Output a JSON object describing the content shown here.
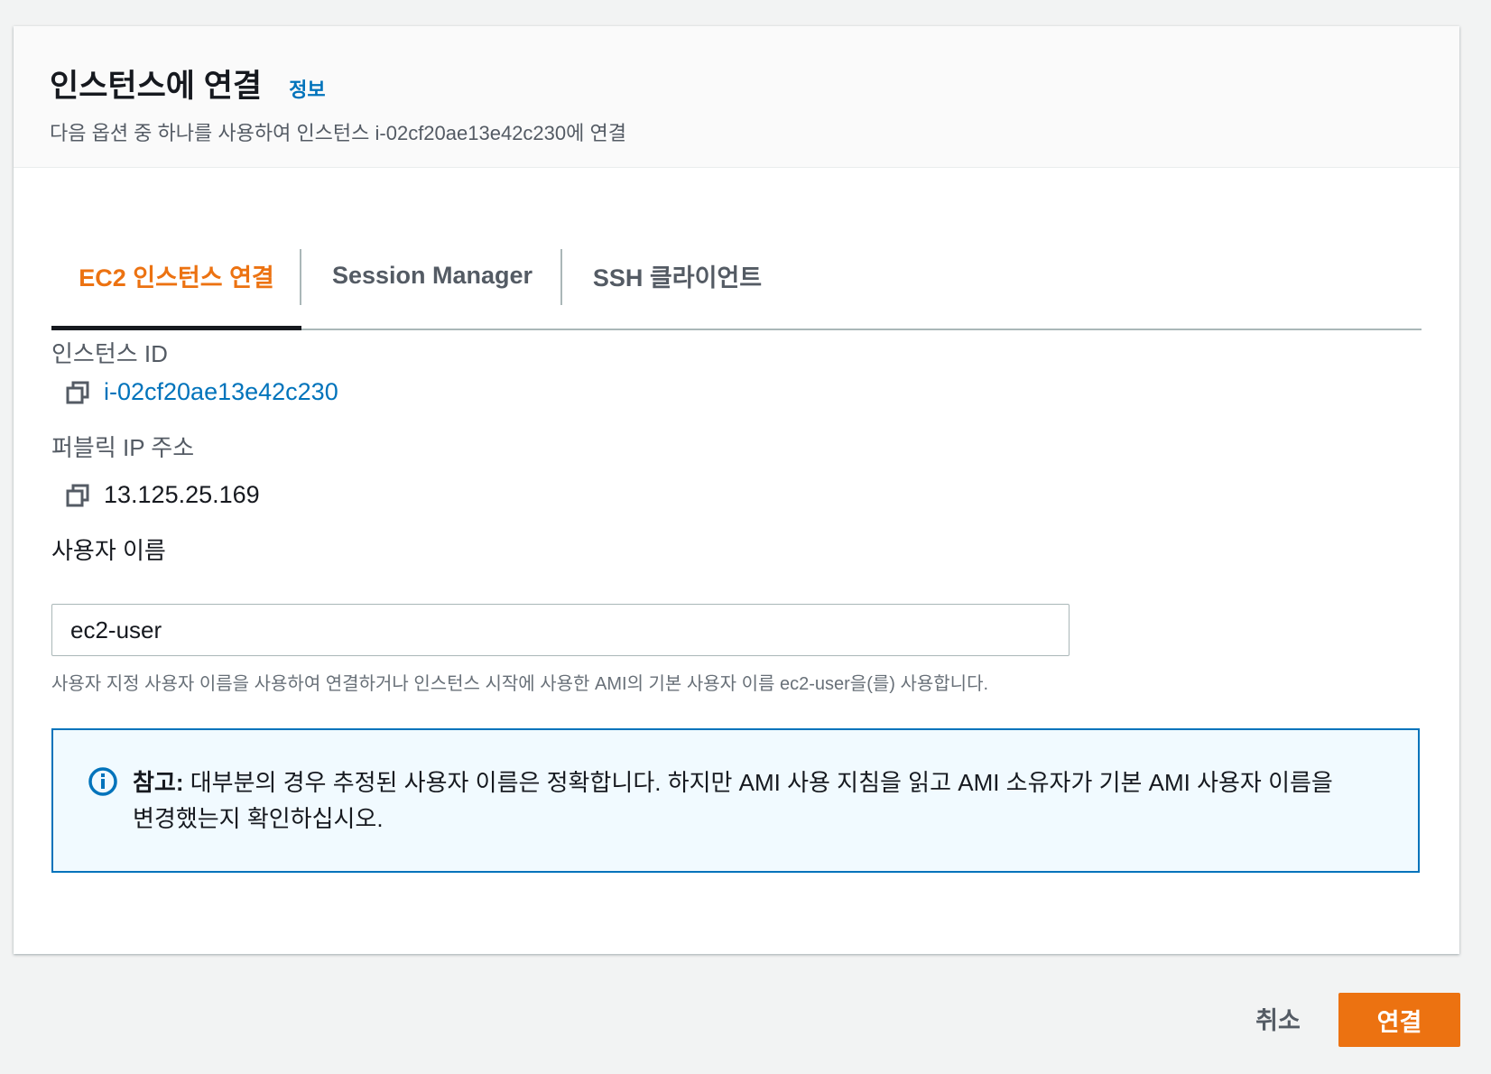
{
  "header": {
    "title": "인스턴스에 연결",
    "info_link": "정보",
    "subtitle": "다음 옵션 중 하나를 사용하여 인스턴스 i-02cf20ae13e42c230에 연결"
  },
  "tabs": [
    {
      "label": "EC2 인스턴스 연결",
      "active": true
    },
    {
      "label": "Session Manager",
      "active": false
    },
    {
      "label": "SSH 클라이언트",
      "active": false
    }
  ],
  "fields": {
    "instance_id": {
      "label": "인스턴스 ID",
      "value": "i-02cf20ae13e42c230",
      "icon": "copy-icon"
    },
    "public_ip": {
      "label": "퍼블릭 IP 주소",
      "value": "13.125.25.169",
      "icon": "copy-icon"
    },
    "username": {
      "label": "사용자 이름",
      "value": "ec2-user",
      "hint": "사용자 지정 사용자 이름을 사용하여 연결하거나 인스턴스 시작에 사용한 AMI의 기본 사용자 이름 ec2-user을(를) 사용합니다."
    }
  },
  "alert": {
    "icon": "info-icon",
    "title": "참고:",
    "line1": " 대부분의 경우 추정된 사용자 이름은 정확합니다. 하지만 AMI 사용 지침을 읽고 AMI 소유자가 기본 AMI 사용자 이름을",
    "line2": "변경했는지 확인하십시오."
  },
  "footer": {
    "cancel_label": "취소",
    "connect_label": "연결"
  },
  "colors": {
    "accent": "#ec7211",
    "link": "#0073bb",
    "info_border": "#0073bb",
    "info_bg": "#f1faff"
  }
}
